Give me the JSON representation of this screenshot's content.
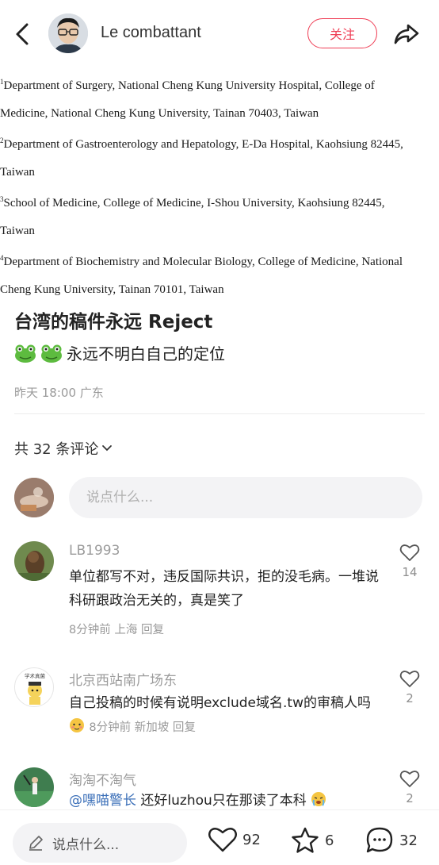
{
  "header": {
    "author_name": "Le combattant",
    "follow_label": "关注"
  },
  "paper": {
    "affiliations": [
      {
        "sup": "1",
        "line1": "Department of Surgery, National Cheng Kung University Hospital, College of",
        "line2": "Medicine, National Cheng Kung University, Tainan 70403, Taiwan"
      },
      {
        "sup": "2",
        "line1": "Department of Gastroenterology and Hepatology, E-Da Hospital, Kaohsiung 82445,",
        "line2": "Taiwan"
      },
      {
        "sup": "3",
        "line1": "School of Medicine, College of Medicine, I-Shou University, Kaohsiung 82445,",
        "line2": "Taiwan"
      },
      {
        "sup": "4",
        "line1": "Department of Biochemistry and Molecular Biology, College of Medicine, National",
        "line2": "Cheng Kung University, Tainan 70101, Taiwan"
      }
    ]
  },
  "post": {
    "title": "台湾的稿件永远 Reject",
    "body": "永远不明白自己的定位",
    "meta": "昨天 18:00 广东"
  },
  "comments_section": {
    "count_label": "共 32 条评论",
    "input_placeholder": "说点什么..."
  },
  "comments": [
    {
      "user": "LB1993",
      "text": "单位都写不对，违反国际共识，拒的没毛病。一堆说科研跟政治无关的，真是笑了",
      "meta": "8分钟前 上海 回复",
      "likes": "14"
    },
    {
      "user": "北京西站南广场东",
      "text": "自己投稿的时候有说明exclude域名.tw的审稿人吗",
      "meta": "8分钟前 新加坡 回复",
      "likes": "2",
      "avatar_text": "学术真菌"
    },
    {
      "user": "淘淘不淘气",
      "mention": "@嘿喵警长",
      "text": " 还好luzhou只在那读了本科",
      "likes": "2"
    }
  ],
  "bottom_bar": {
    "input_label": "说点什么...",
    "likes": "92",
    "stars": "6",
    "comments": "32"
  },
  "colors": {
    "accent": "#ef3e55",
    "mention": "#3b6fb8",
    "muted": "#9a9a9a"
  }
}
